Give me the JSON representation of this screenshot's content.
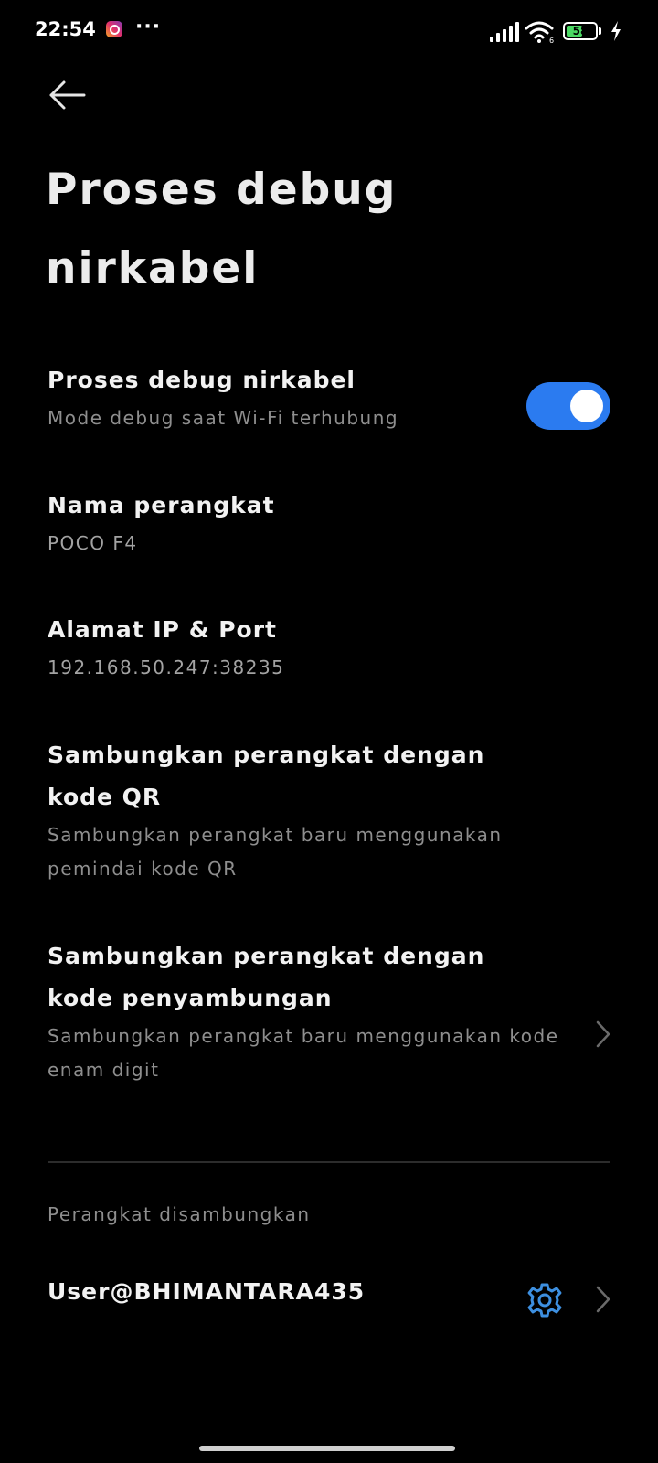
{
  "status_bar": {
    "time": "22:54",
    "more_indicator": "···",
    "battery_percent": "58",
    "battery_level": 0.58,
    "icons": [
      "instagram-icon",
      "signal-icon",
      "wifi-icon",
      "battery-icon",
      "charging-icon"
    ]
  },
  "header": {
    "back_icon": "arrow-left-icon",
    "title": "Proses debug nirkabel"
  },
  "settings": {
    "wireless_debug": {
      "title": "Proses debug nirkabel",
      "subtitle": "Mode debug saat Wi-Fi terhubung",
      "enabled": true
    },
    "device_name": {
      "title": "Nama perangkat",
      "value": "POCO F4"
    },
    "ip_port": {
      "title": "Alamat IP & Port",
      "value": "192.168.50.247:38235"
    },
    "pair_qr": {
      "title": "Sambungkan perangkat dengan kode QR",
      "subtitle": "Sambungkan perangkat baru menggunakan pemindai kode QR"
    },
    "pair_code": {
      "title": "Sambungkan perangkat dengan kode penyambungan",
      "subtitle": "Sambungkan perangkat baru menggunakan kode enam digit"
    }
  },
  "paired_devices": {
    "header": "Perangkat disambungkan",
    "items": [
      {
        "name": "User@BHIMANTARA435"
      }
    ]
  },
  "colors": {
    "background": "#000000",
    "accent": "#2b7bf0",
    "primary_text": "#f2f2f2",
    "secondary_text": "#8e8e8e",
    "gear": "#3d8fe0"
  }
}
